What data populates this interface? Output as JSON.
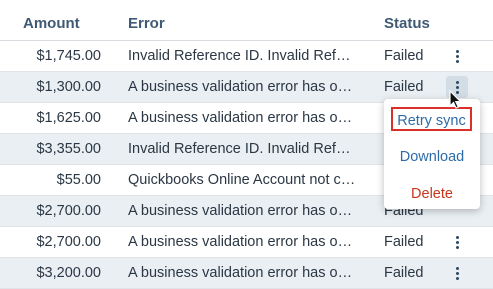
{
  "columns": {
    "amount": "Amount",
    "error": "Error",
    "status": "Status"
  },
  "rows": [
    {
      "amount": "$1,745.00",
      "error": "Invalid Reference ID. Invalid Reference ID.",
      "status": "Failed"
    },
    {
      "amount": "$1,300.00",
      "error": "A business validation error has occurred",
      "status": "Failed"
    },
    {
      "amount": "$1,625.00",
      "error": "A business validation error has occurred",
      "status": ""
    },
    {
      "amount": "$3,355.00",
      "error": "Invalid Reference ID. Invalid Reference ID.",
      "status": ""
    },
    {
      "amount": "$55.00",
      "error": "Quickbooks Online Account not connected",
      "status": ""
    },
    {
      "amount": "$2,700.00",
      "error": "A business validation error has occurred",
      "status": "Failed"
    },
    {
      "amount": "$2,700.00",
      "error": "A business validation error has occurred",
      "status": "Failed"
    },
    {
      "amount": "$3,200.00",
      "error": "A business validation error has occurred",
      "status": "Failed"
    }
  ],
  "menu": {
    "retry": "Retry sync",
    "download": "Download",
    "delete": "Delete"
  },
  "colors": {
    "header_text": "#3f5a74",
    "row_alt": "#e9eff3",
    "link": "#2e6ca8",
    "danger": "#c8361d",
    "highlight_border": "#d9302c"
  }
}
